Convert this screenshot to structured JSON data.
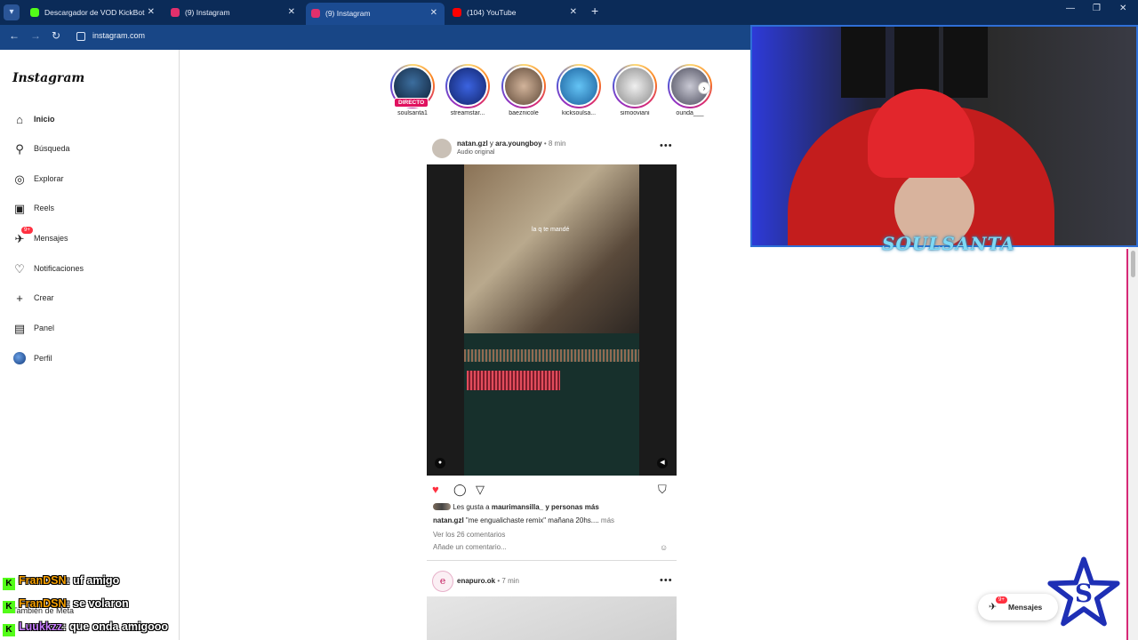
{
  "browser": {
    "tabs": [
      {
        "title": "Descargador de VOD KickBot",
        "icon_color": "#53fc18"
      },
      {
        "title": "(9) Instagram",
        "icon_color": "#e1306c"
      },
      {
        "title": "(9) Instagram",
        "icon_color": "#e1306c",
        "active": true
      },
      {
        "title": "(104) YouTube",
        "icon_color": "#ff0000"
      }
    ],
    "url": "instagram.com"
  },
  "sidebar": {
    "logo": "Instagram",
    "items": [
      {
        "label": "Inicio",
        "icon": "home-icon"
      },
      {
        "label": "Búsqueda",
        "icon": "search-icon"
      },
      {
        "label": "Explorar",
        "icon": "compass-icon"
      },
      {
        "label": "Reels",
        "icon": "reels-icon"
      },
      {
        "label": "Mensajes",
        "icon": "messenger-icon",
        "badge": "9+"
      },
      {
        "label": "Notificaciones",
        "icon": "heart-icon"
      },
      {
        "label": "Crear",
        "icon": "plus-icon"
      },
      {
        "label": "Panel",
        "icon": "chart-icon"
      },
      {
        "label": "Perfil",
        "icon": "profile-avatar-icon"
      }
    ],
    "meta": "También de Meta"
  },
  "stories": [
    {
      "name": "soulsanta1",
      "live": "DIRECTO",
      "color": "#3c6e9e"
    },
    {
      "name": "streamstar...",
      "color": "#1f3fb0"
    },
    {
      "name": "baeznicole",
      "color": "#b79a83"
    },
    {
      "name": "kicksoulsa...",
      "color": "#3fa0e0"
    },
    {
      "name": "simooviani",
      "color": "#d9d9d9"
    },
    {
      "name": "ounda___",
      "color": "#9a9aa8"
    }
  ],
  "post": {
    "user": "natan.gzl",
    "connector": "y",
    "coauthor": "ara.youngboy",
    "time": "8 min",
    "audio": "Audio original",
    "overlay_caption": "la q te mandé",
    "likes_prefix": "Les gusta a",
    "likes_user": "maurimansilla_",
    "likes_suffix": "y personas más",
    "caption_user": "natan.gzl",
    "caption_text": "\"me engualichaste remix\" mañana 20hs....",
    "caption_more": "más",
    "comments_link": "Ver los 26 comentarios",
    "add_comment": "Añade un comentario..."
  },
  "post2": {
    "avatar_letter": "e",
    "user": "enapuro.ok",
    "time": "7 min"
  },
  "messages_pill": {
    "label": "Mensajes",
    "badge": "9+"
  },
  "stream": {
    "overlay_name": "SOULSANTA"
  },
  "chat": [
    {
      "user": "FranDSN",
      "message": ": uf amigo",
      "color": "#f7a000"
    },
    {
      "user": "FranDSN",
      "message": ": se volaron",
      "color": "#f7a000"
    },
    {
      "user": "Luukkzz",
      "message": ": que onda amigooo",
      "color": "#c77dff"
    }
  ]
}
